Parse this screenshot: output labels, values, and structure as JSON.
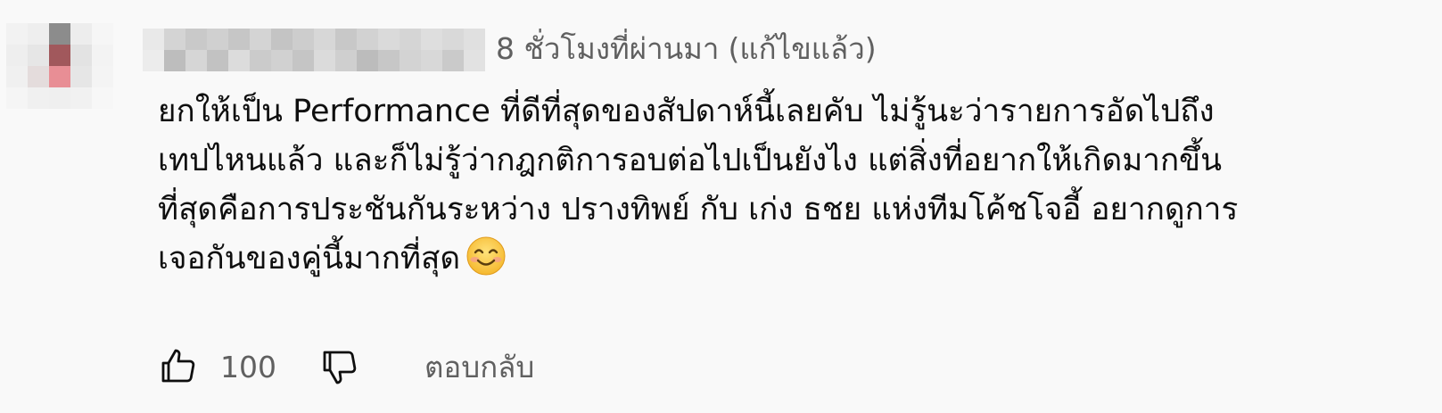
{
  "comment": {
    "meta_time": "8 ชั่วโมงที่ผ่านมา",
    "meta_edited": "(แก้ไขแล้ว)",
    "text_lines": [
      "ยกให้เป็น Performance ที่ดีที่สุดของสัปดาห์นี้เลยคับ ไม่รู้นะว่ารายการอัดไปถึง",
      "เทปไหนแล้ว และก็ไม่รู้ว่ากฎกติการอบต่อไปเป็นยังไง แต่สิ่งที่อยากให้เกิดมากขึ้น",
      "ที่สุดคือการประชันกันระหว่าง ปรางทิพย์ กับ เก่ง ธชย แห่งทีมโค้ชโจอี้ อยากดูการ",
      "เจอกันของคู่นี้มากที่สุด"
    ],
    "emoji": "smiling-face-emoji",
    "like_count": "100",
    "reply_label": "ตอบกลับ"
  },
  "icons": {
    "like": "thumbs-up-icon",
    "dislike": "thumbs-down-icon"
  },
  "colors": {
    "background": "#f9f9f9",
    "text": "#0f0f0f",
    "secondary_text": "#606060"
  }
}
